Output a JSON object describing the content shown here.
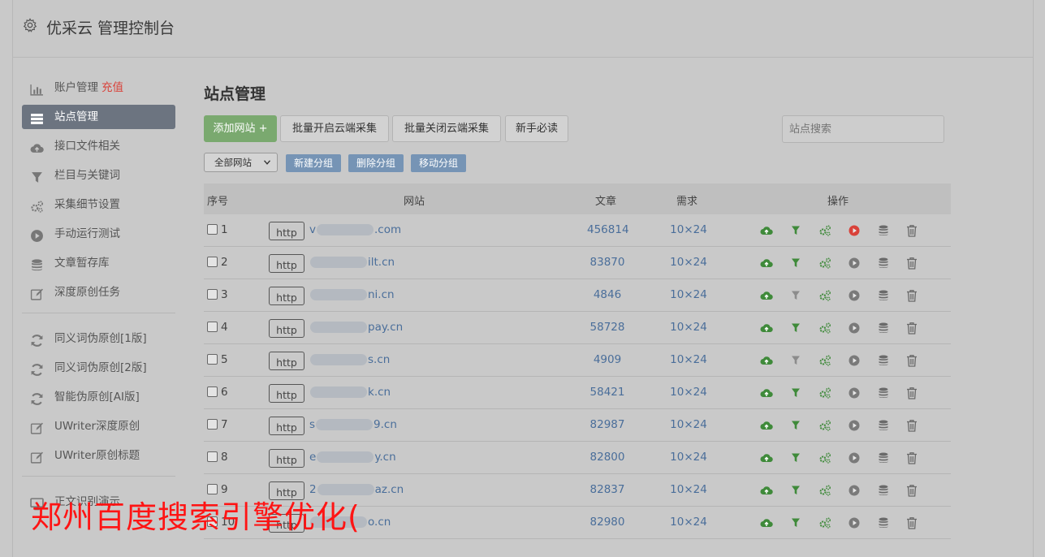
{
  "header": {
    "title": "优采云 管理控制台",
    "icon": "gear-icon"
  },
  "sidebar": {
    "items": [
      {
        "label": "账户管理",
        "highlight": "充值",
        "icon": "bar-chart-icon",
        "active": false
      },
      {
        "label": "站点管理",
        "icon": "list-icon",
        "active": true
      },
      {
        "label": "接口文件相关",
        "icon": "cloud-upload-icon",
        "active": false
      },
      {
        "label": "栏目与关键词",
        "icon": "filter-icon",
        "active": false
      },
      {
        "label": "采集细节设置",
        "icon": "gears-icon",
        "active": false
      },
      {
        "label": "手动运行测试",
        "icon": "play-icon",
        "active": false
      },
      {
        "label": "文章暂存库",
        "icon": "database-icon",
        "active": false
      },
      {
        "label": "深度原创任务",
        "icon": "edit-icon",
        "active": false
      }
    ],
    "items2": [
      {
        "label": "同义词伪原创[1版]",
        "icon": "refresh-icon"
      },
      {
        "label": "同义词伪原创[2版]",
        "icon": "refresh-icon"
      },
      {
        "label": "智能伪原创[AI版]",
        "icon": "refresh-icon"
      },
      {
        "label": "UWriter深度原创",
        "icon": "edit-icon"
      },
      {
        "label": "UWriter原创标题",
        "icon": "edit-icon"
      }
    ],
    "bottom_item": {
      "label": "正文识别演示",
      "icon": "monitor-icon"
    }
  },
  "main": {
    "title": "站点管理",
    "toolbar": {
      "add_site": "添加网站 +",
      "batch_open": "批量开启云端采集",
      "batch_close": "批量关闭云端采集",
      "beginner": "新手必读",
      "search_placeholder": "站点搜索"
    },
    "group": {
      "select_value": "全部网站",
      "new_group": "新建分组",
      "delete_group": "删除分组",
      "move_group": "移动分组"
    },
    "table": {
      "headers": {
        "no": "序号",
        "site": "网站",
        "articles": "文章",
        "demand": "需求",
        "ops": "操作"
      },
      "rows": [
        {
          "no": "1",
          "prefix": "http",
          "site_start": "v",
          "site_end": ".com",
          "articles": "456814",
          "demand": "10×24",
          "filter_active": true,
          "play_active": true
        },
        {
          "no": "2",
          "prefix": "http",
          "site_start": "",
          "site_end": "ilt.cn",
          "articles": "83870",
          "demand": "10×24",
          "filter_active": true,
          "play_active": false
        },
        {
          "no": "3",
          "prefix": "http",
          "site_start": "",
          "site_end": "ni.cn",
          "articles": "4846",
          "demand": "10×24",
          "filter_active": false,
          "play_active": false
        },
        {
          "no": "4",
          "prefix": "http",
          "site_start": "",
          "site_end": "pay.cn",
          "articles": "58728",
          "demand": "10×24",
          "filter_active": true,
          "play_active": false
        },
        {
          "no": "5",
          "prefix": "http",
          "site_start": "",
          "site_end": "s.cn",
          "articles": "4909",
          "demand": "10×24",
          "filter_active": false,
          "play_active": false
        },
        {
          "no": "6",
          "prefix": "http",
          "site_start": "",
          "site_end": "k.cn",
          "articles": "58421",
          "demand": "10×24",
          "filter_active": true,
          "play_active": false
        },
        {
          "no": "7",
          "prefix": "http",
          "site_start": "s",
          "site_end": "9.cn",
          "articles": "82987",
          "demand": "10×24",
          "filter_active": true,
          "play_active": false
        },
        {
          "no": "8",
          "prefix": "http",
          "site_start": "e",
          "site_end": "y.cn",
          "articles": "82800",
          "demand": "10×24",
          "filter_active": true,
          "play_active": false
        },
        {
          "no": "9",
          "prefix": "http",
          "site_start": "2",
          "site_end": "az.cn",
          "articles": "82837",
          "demand": "10×24",
          "filter_active": true,
          "play_active": false
        },
        {
          "no": "10",
          "prefix": "http",
          "site_start": "",
          "site_end": "o.cn",
          "articles": "82980",
          "demand": "10×24",
          "filter_active": true,
          "play_active": false
        }
      ]
    }
  },
  "watermark": "郑州百度搜索引擎优化(",
  "colors": {
    "accent_green": "#7aa96f",
    "active_sidebar": "#6c7480",
    "link_blue": "#4a6e9a",
    "play_red": "#d9423a",
    "watermark_red": "#ff1414"
  }
}
